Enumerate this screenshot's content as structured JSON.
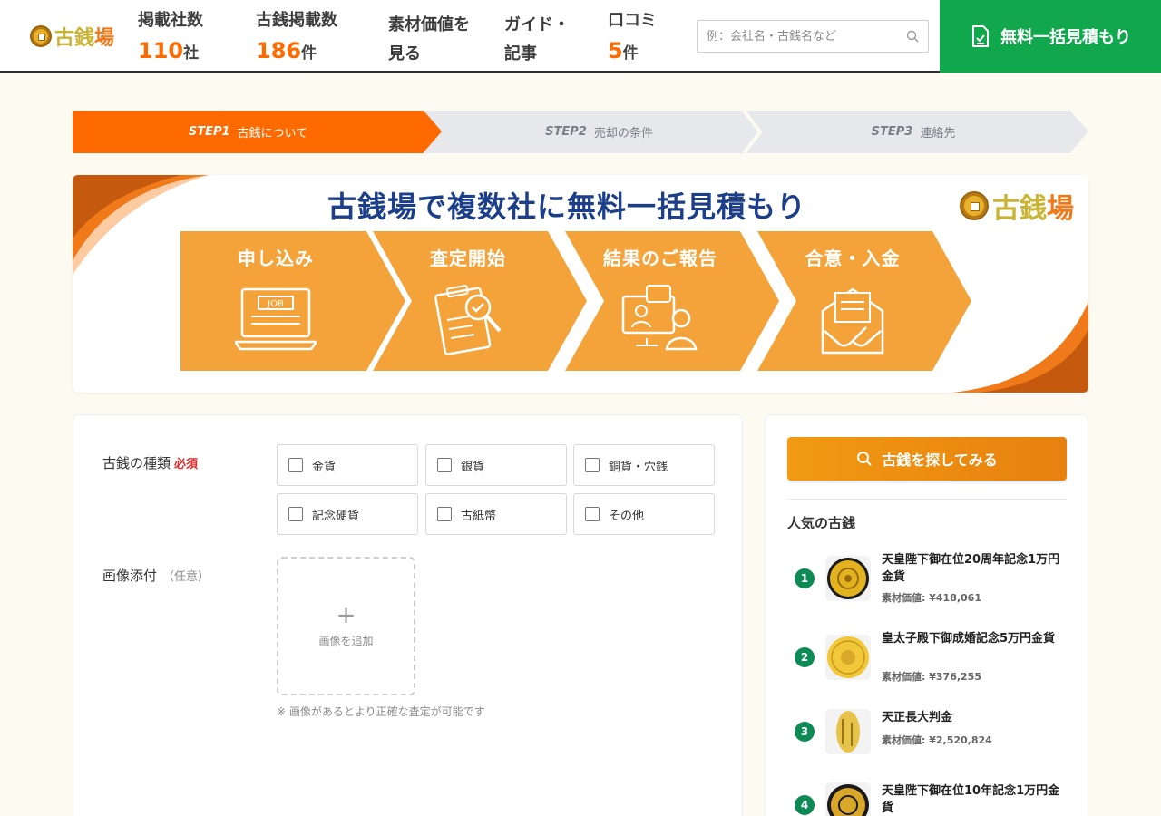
{
  "header": {
    "logo": [
      "古",
      "銭",
      "場"
    ],
    "stats": [
      {
        "label": "掲載社数",
        "value": "110",
        "unit": "社"
      },
      {
        "label": "古銭掲載数",
        "value": "186",
        "unit": "件"
      },
      {
        "label": "口コミ",
        "value": "5",
        "unit": "件"
      }
    ],
    "nav": [
      {
        "line1": "素材価値を",
        "line2": "見る"
      },
      {
        "line1": "ガイド・",
        "line2": "記事"
      }
    ],
    "search_placeholder": "例：会社名・古銭名など",
    "cta_label": "無料一括見積もり"
  },
  "steps": [
    {
      "num": "STEP1",
      "label": "古銭について"
    },
    {
      "num": "STEP2",
      "label": "売却の条件"
    },
    {
      "num": "STEP3",
      "label": "連絡先"
    }
  ],
  "banner": {
    "title": "古銭場で複数社に無料一括見積もり",
    "logo": [
      "古",
      "銭",
      "場"
    ],
    "flow": [
      "申し込み",
      "査定開始",
      "結果のご報告",
      "合意・入金"
    ],
    "job_text": "JOB"
  },
  "form": {
    "type_label": "古銭の種類",
    "required": "必須",
    "options": [
      "金貨",
      "銀貨",
      "銅貨・穴銭",
      "記念硬貨",
      "古紙幣",
      "その他"
    ],
    "image_label": "画像添付",
    "optional": "（任意）",
    "upload_plus": "+",
    "upload_text": "画像を追加",
    "note": "※ 画像があるとより正確な査定が可能です"
  },
  "sidebar": {
    "search_button": "古銭を探してみる",
    "popular_title": "人気の古銭",
    "items": [
      {
        "rank": "1",
        "name": "天皇陛下御在位20周年記念1万円金貨",
        "price": "素材価値: ¥418,061"
      },
      {
        "rank": "2",
        "name": "皇太子殿下御成婚記念5万円金貨",
        "price": "素材価値: ¥376,255"
      },
      {
        "rank": "3",
        "name": "天正長大判金",
        "price": "素材価値: ¥2,520,824"
      },
      {
        "rank": "4",
        "name": "天皇陛下御在位10年記念1万円金貨",
        "price": ""
      }
    ]
  },
  "colors": {
    "accent": "#ff6a00",
    "cta": "#11a84d",
    "navy": "#1d3f8a",
    "flow": "#f4a33a",
    "rank": "#0e8a55"
  }
}
